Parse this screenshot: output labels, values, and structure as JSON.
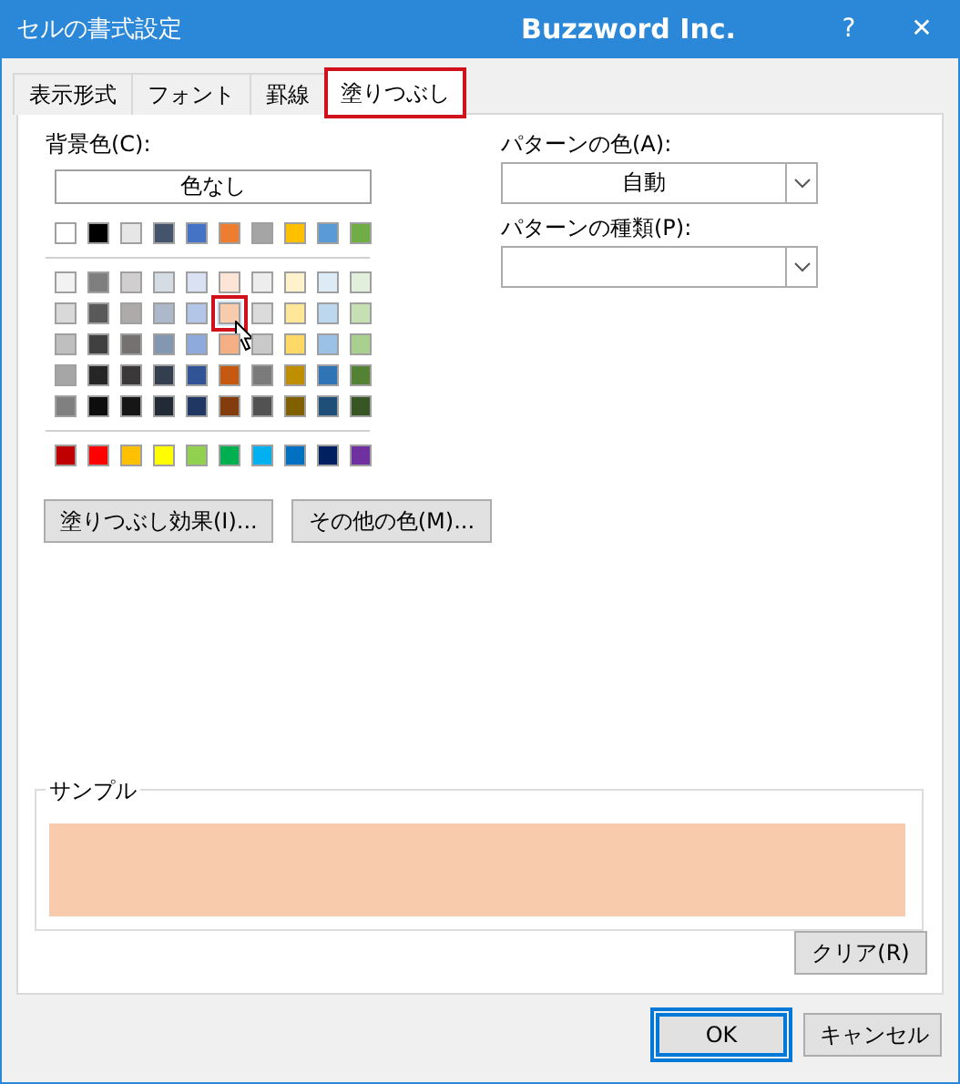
{
  "window": {
    "title": "セルの書式設定",
    "brand": "Buzzword Inc.",
    "help": "?",
    "close": "✕"
  },
  "tabs": [
    {
      "label": "表示形式",
      "selected": false,
      "highlighted": false
    },
    {
      "label": "フォント",
      "selected": false,
      "highlighted": false
    },
    {
      "label": "罫線",
      "selected": false,
      "highlighted": false
    },
    {
      "label": "塗りつぶし",
      "selected": true,
      "highlighted": true
    }
  ],
  "background_color": {
    "label": "背景色(C):",
    "no_color_button": "色なし",
    "theme_row": [
      {
        "color": "#ffffff",
        "selected": false
      },
      {
        "color": "#000000",
        "selected": false
      },
      {
        "color": "#e7e6e6",
        "selected": false
      },
      {
        "color": "#44546a",
        "selected": false
      },
      {
        "color": "#4472c4",
        "selected": false
      },
      {
        "color": "#ed7d31",
        "selected": false
      },
      {
        "color": "#a5a5a5",
        "selected": false
      },
      {
        "color": "#ffc000",
        "selected": false
      },
      {
        "color": "#5b9bd5",
        "selected": false
      },
      {
        "color": "#70ad47",
        "selected": false
      }
    ],
    "tint_rows": [
      [
        {
          "color": "#f2f2f2",
          "selected": false
        },
        {
          "color": "#7f7f7f",
          "selected": false
        },
        {
          "color": "#d0cece",
          "selected": false
        },
        {
          "color": "#d6dce4",
          "selected": false
        },
        {
          "color": "#d9e1f2",
          "selected": false
        },
        {
          "color": "#fce4d6",
          "selected": false
        },
        {
          "color": "#ededed",
          "selected": false
        },
        {
          "color": "#fff2cc",
          "selected": false
        },
        {
          "color": "#ddebf7",
          "selected": false
        },
        {
          "color": "#e2efda",
          "selected": false
        }
      ],
      [
        {
          "color": "#d9d9d9",
          "selected": false
        },
        {
          "color": "#595959",
          "selected": false
        },
        {
          "color": "#aeaaaa",
          "selected": false
        },
        {
          "color": "#acb9ca",
          "selected": false
        },
        {
          "color": "#b4c6e7",
          "selected": false
        },
        {
          "color": "#f8cbad",
          "selected": true
        },
        {
          "color": "#dbdbdb",
          "selected": false
        },
        {
          "color": "#ffe699",
          "selected": false
        },
        {
          "color": "#bdd7ee",
          "selected": false
        },
        {
          "color": "#c6e0b4",
          "selected": false
        }
      ],
      [
        {
          "color": "#bfbfbf",
          "selected": false
        },
        {
          "color": "#404040",
          "selected": false
        },
        {
          "color": "#757171",
          "selected": false
        },
        {
          "color": "#8497b0",
          "selected": false
        },
        {
          "color": "#8ea9db",
          "selected": false
        },
        {
          "color": "#f4b084",
          "selected": false
        },
        {
          "color": "#c9c9c9",
          "selected": false
        },
        {
          "color": "#ffd966",
          "selected": false
        },
        {
          "color": "#9bc2e6",
          "selected": false
        },
        {
          "color": "#a9d08e",
          "selected": false
        }
      ],
      [
        {
          "color": "#a6a6a6",
          "selected": false
        },
        {
          "color": "#262626",
          "selected": false
        },
        {
          "color": "#3a3838",
          "selected": false
        },
        {
          "color": "#333f4f",
          "selected": false
        },
        {
          "color": "#305496",
          "selected": false
        },
        {
          "color": "#c65911",
          "selected": false
        },
        {
          "color": "#7b7b7b",
          "selected": false
        },
        {
          "color": "#bf8f00",
          "selected": false
        },
        {
          "color": "#2f75b5",
          "selected": false
        },
        {
          "color": "#548235",
          "selected": false
        }
      ],
      [
        {
          "color": "#808080",
          "selected": false
        },
        {
          "color": "#0d0d0d",
          "selected": false
        },
        {
          "color": "#161616",
          "selected": false
        },
        {
          "color": "#222b35",
          "selected": false
        },
        {
          "color": "#203764",
          "selected": false
        },
        {
          "color": "#833c0c",
          "selected": false
        },
        {
          "color": "#525252",
          "selected": false
        },
        {
          "color": "#806000",
          "selected": false
        },
        {
          "color": "#1f4e78",
          "selected": false
        },
        {
          "color": "#375623",
          "selected": false
        }
      ]
    ],
    "standard_row": [
      {
        "color": "#c00000",
        "selected": false
      },
      {
        "color": "#ff0000",
        "selected": false
      },
      {
        "color": "#ffc000",
        "selected": false
      },
      {
        "color": "#ffff00",
        "selected": false
      },
      {
        "color": "#92d050",
        "selected": false
      },
      {
        "color": "#00b050",
        "selected": false
      },
      {
        "color": "#00b0f0",
        "selected": false
      },
      {
        "color": "#0070c0",
        "selected": false
      },
      {
        "color": "#002060",
        "selected": false
      },
      {
        "color": "#7030a0",
        "selected": false
      }
    ],
    "buttons": [
      "塗りつぶし効果(I)...",
      "その他の色(M)..."
    ]
  },
  "pattern_color": {
    "label": "パターンの色(A):",
    "value": "自動"
  },
  "pattern_style": {
    "label": "パターンの種類(P):"
  },
  "sample": {
    "label": "サンプル",
    "color": "#f8cbad"
  },
  "clear_button": "クリア(R)",
  "footer_buttons": [
    {
      "label": "OK",
      "default": true,
      "highlighted": true
    },
    {
      "label": "キャンセル",
      "default": false,
      "highlighted": false
    }
  ]
}
